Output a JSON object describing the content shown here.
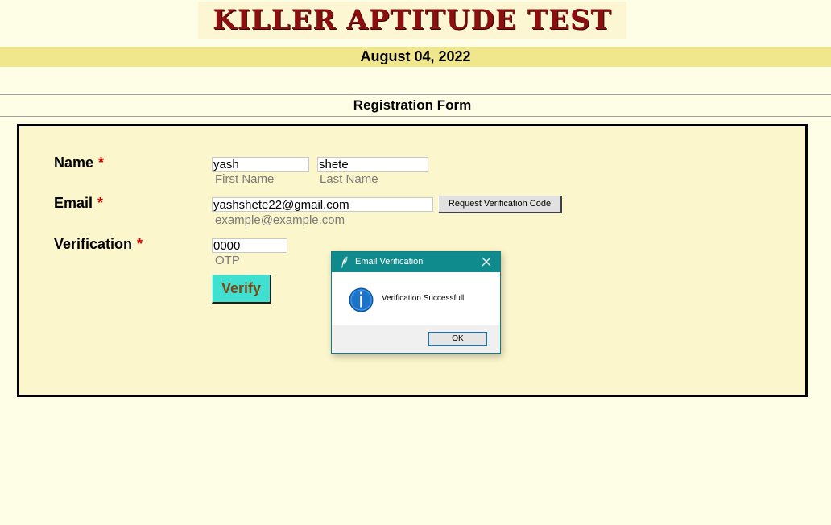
{
  "header": {
    "app_title": "KILLER APTITUDE TEST",
    "date": "August 04, 2022"
  },
  "form": {
    "heading": "Registration Form",
    "required_marker": "*",
    "name": {
      "label": "Name",
      "first_value": "yash",
      "first_hint": "First Name",
      "last_value": "shete",
      "last_hint": "Last Name"
    },
    "email": {
      "label": "Email",
      "value": "yashshete22@gmail.com",
      "hint": "example@example.com",
      "request_button_label": "Request Verification Code"
    },
    "verification": {
      "label": "Verification",
      "value": "0000",
      "hint": "OTP",
      "verify_button_label": "Verify"
    }
  },
  "dialog": {
    "title": "Email Verification",
    "message": "Verification Successfull",
    "ok_label": "OK",
    "icons": [
      "feather-icon",
      "close-icon",
      "info-icon"
    ]
  },
  "colors": {
    "page_background": "#fefee6",
    "title_color": "#8b0f0f",
    "date_bar": "#f0e68c",
    "form_panel": "#fcf6cc",
    "required_marker": "#d40000",
    "verify_button": "#40e0d0",
    "dialog_titlebar": "#0f8b8d",
    "info_icon": "#1a73c8"
  }
}
